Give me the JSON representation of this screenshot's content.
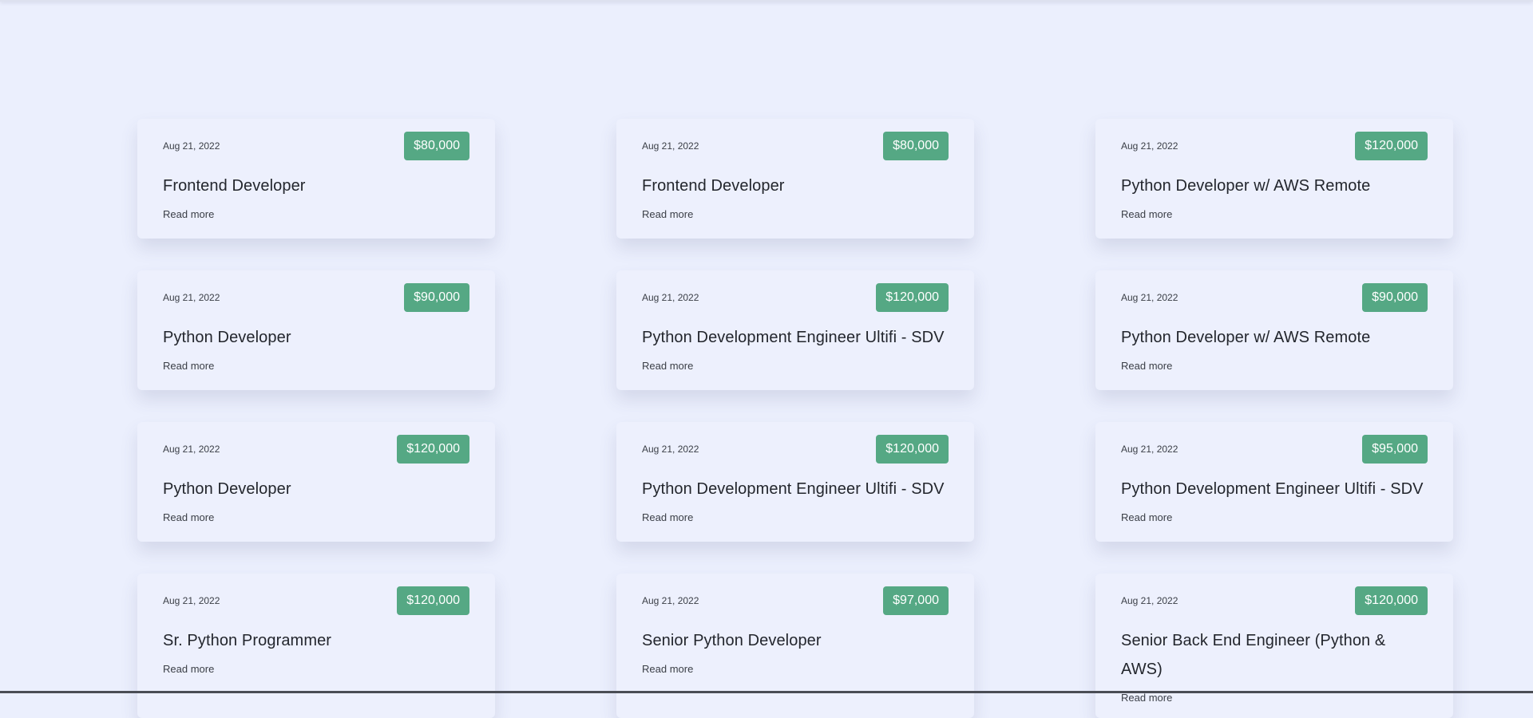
{
  "jobs": [
    {
      "date": "Aug 21, 2022",
      "salary": "$80,000",
      "title": "Frontend Developer",
      "read_more": "Read more"
    },
    {
      "date": "Aug 21, 2022",
      "salary": "$80,000",
      "title": "Frontend Developer",
      "read_more": "Read more"
    },
    {
      "date": "Aug 21, 2022",
      "salary": "$120,000",
      "title": "Python Developer w/ AWS Remote",
      "read_more": "Read more"
    },
    {
      "date": "Aug 21, 2022",
      "salary": "$90,000",
      "title": "Python Developer",
      "read_more": "Read more"
    },
    {
      "date": "Aug 21, 2022",
      "salary": "$120,000",
      "title": "Python Development Engineer Ultifi - SDV",
      "read_more": "Read more"
    },
    {
      "date": "Aug 21, 2022",
      "salary": "$90,000",
      "title": "Python Developer w/ AWS Remote",
      "read_more": "Read more"
    },
    {
      "date": "Aug 21, 2022",
      "salary": "$120,000",
      "title": "Python Developer",
      "read_more": "Read more"
    },
    {
      "date": "Aug 21, 2022",
      "salary": "$120,000",
      "title": "Python Development Engineer Ultifi - SDV",
      "read_more": "Read more"
    },
    {
      "date": "Aug 21, 2022",
      "salary": "$95,000",
      "title": "Python Development Engineer Ultifi - SDV",
      "read_more": "Read more"
    },
    {
      "date": "Aug 21, 2022",
      "salary": "$120,000",
      "title": "Sr. Python Programmer",
      "read_more": "Read more"
    },
    {
      "date": "Aug 21, 2022",
      "salary": "$97,000",
      "title": "Senior Python Developer",
      "read_more": "Read more"
    },
    {
      "date": "Aug 21, 2022",
      "salary": "$120,000",
      "title": "Senior Back End Engineer (Python & AWS)",
      "read_more": "Read more"
    }
  ],
  "colors": {
    "page_background": "#ebeffd",
    "card_background": "#edf0fd",
    "salary_badge": "#55a884",
    "text_primary": "#23262d"
  }
}
